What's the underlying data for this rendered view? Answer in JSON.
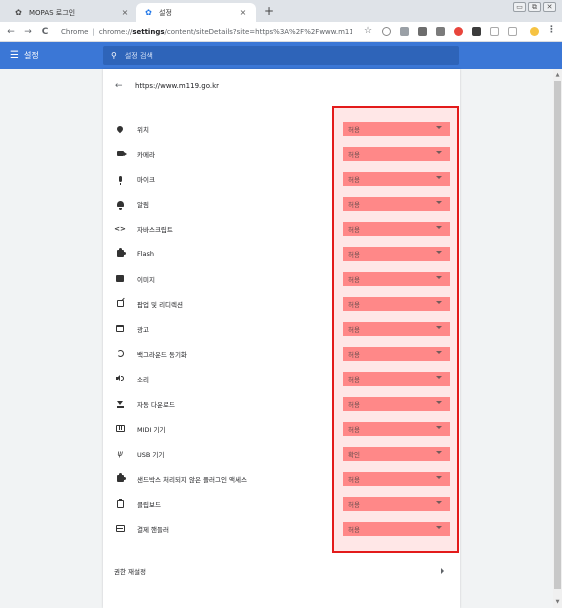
{
  "browser": {
    "tabs": [
      {
        "title": "MOPAS 로그인",
        "active": false
      },
      {
        "title": "설정",
        "active": true
      }
    ],
    "tab_close": "×",
    "new_tab": "+",
    "window_controls": [
      "▭",
      "⧉",
      "✕"
    ],
    "nav": {
      "back": "←",
      "forward": "→",
      "reload": "C"
    },
    "address": {
      "scheme_label": "Chrome",
      "separator": "|",
      "prefix": "chrome://",
      "bold": "settings",
      "rest": "/content/siteDetails?site=https%3A%2F%2Fwww.m11..."
    },
    "star": "☆",
    "menu": "⋮"
  },
  "settings_header": {
    "menu_icon": "☰",
    "title": "설정",
    "search_placeholder": "설정 검색",
    "search_icon": "🔍"
  },
  "site_details": {
    "back_arrow": "←",
    "site_url": "https://www.m119.go.kr",
    "permissions": [
      {
        "icon": "location-pin-icon",
        "label": "위치",
        "value": "허용"
      },
      {
        "icon": "camera-icon",
        "label": "카메라",
        "value": "허용"
      },
      {
        "icon": "microphone-icon",
        "label": "마이크",
        "value": "허용"
      },
      {
        "icon": "bell-icon",
        "label": "알림",
        "value": "허용"
      },
      {
        "icon": "code-icon",
        "label": "자바스크립트",
        "value": "허용"
      },
      {
        "icon": "puzzle-icon",
        "label": "Flash",
        "value": "허용"
      },
      {
        "icon": "image-icon",
        "label": "이미지",
        "value": "허용"
      },
      {
        "icon": "popup-icon",
        "label": "팝업 및 리디렉션",
        "value": "허용"
      },
      {
        "icon": "ads-icon",
        "label": "광고",
        "value": "허용"
      },
      {
        "icon": "sync-icon",
        "label": "백그라운드 동기화",
        "value": "허용"
      },
      {
        "icon": "sound-icon",
        "label": "소리",
        "value": "허용"
      },
      {
        "icon": "download-icon",
        "label": "자동 다운로드",
        "value": "허용"
      },
      {
        "icon": "midi-icon",
        "label": "MIDI 기기",
        "value": "허용"
      },
      {
        "icon": "usb-icon",
        "label": "USB 기기",
        "value": "확인"
      },
      {
        "icon": "puzzle-icon",
        "label": "샌드박스 처리되지 않은 플러그인 액세스",
        "value": "허용"
      },
      {
        "icon": "clipboard-icon",
        "label": "클립보드",
        "value": "허용"
      },
      {
        "icon": "payment-card-icon",
        "label": "결제 핸들러",
        "value": "허용"
      }
    ],
    "reset_label": "권한 재설정"
  },
  "colors": {
    "header_blue": "#3b77d6",
    "select_highlight": "#ff8b8b",
    "annotation_red": "#e31b1b"
  }
}
